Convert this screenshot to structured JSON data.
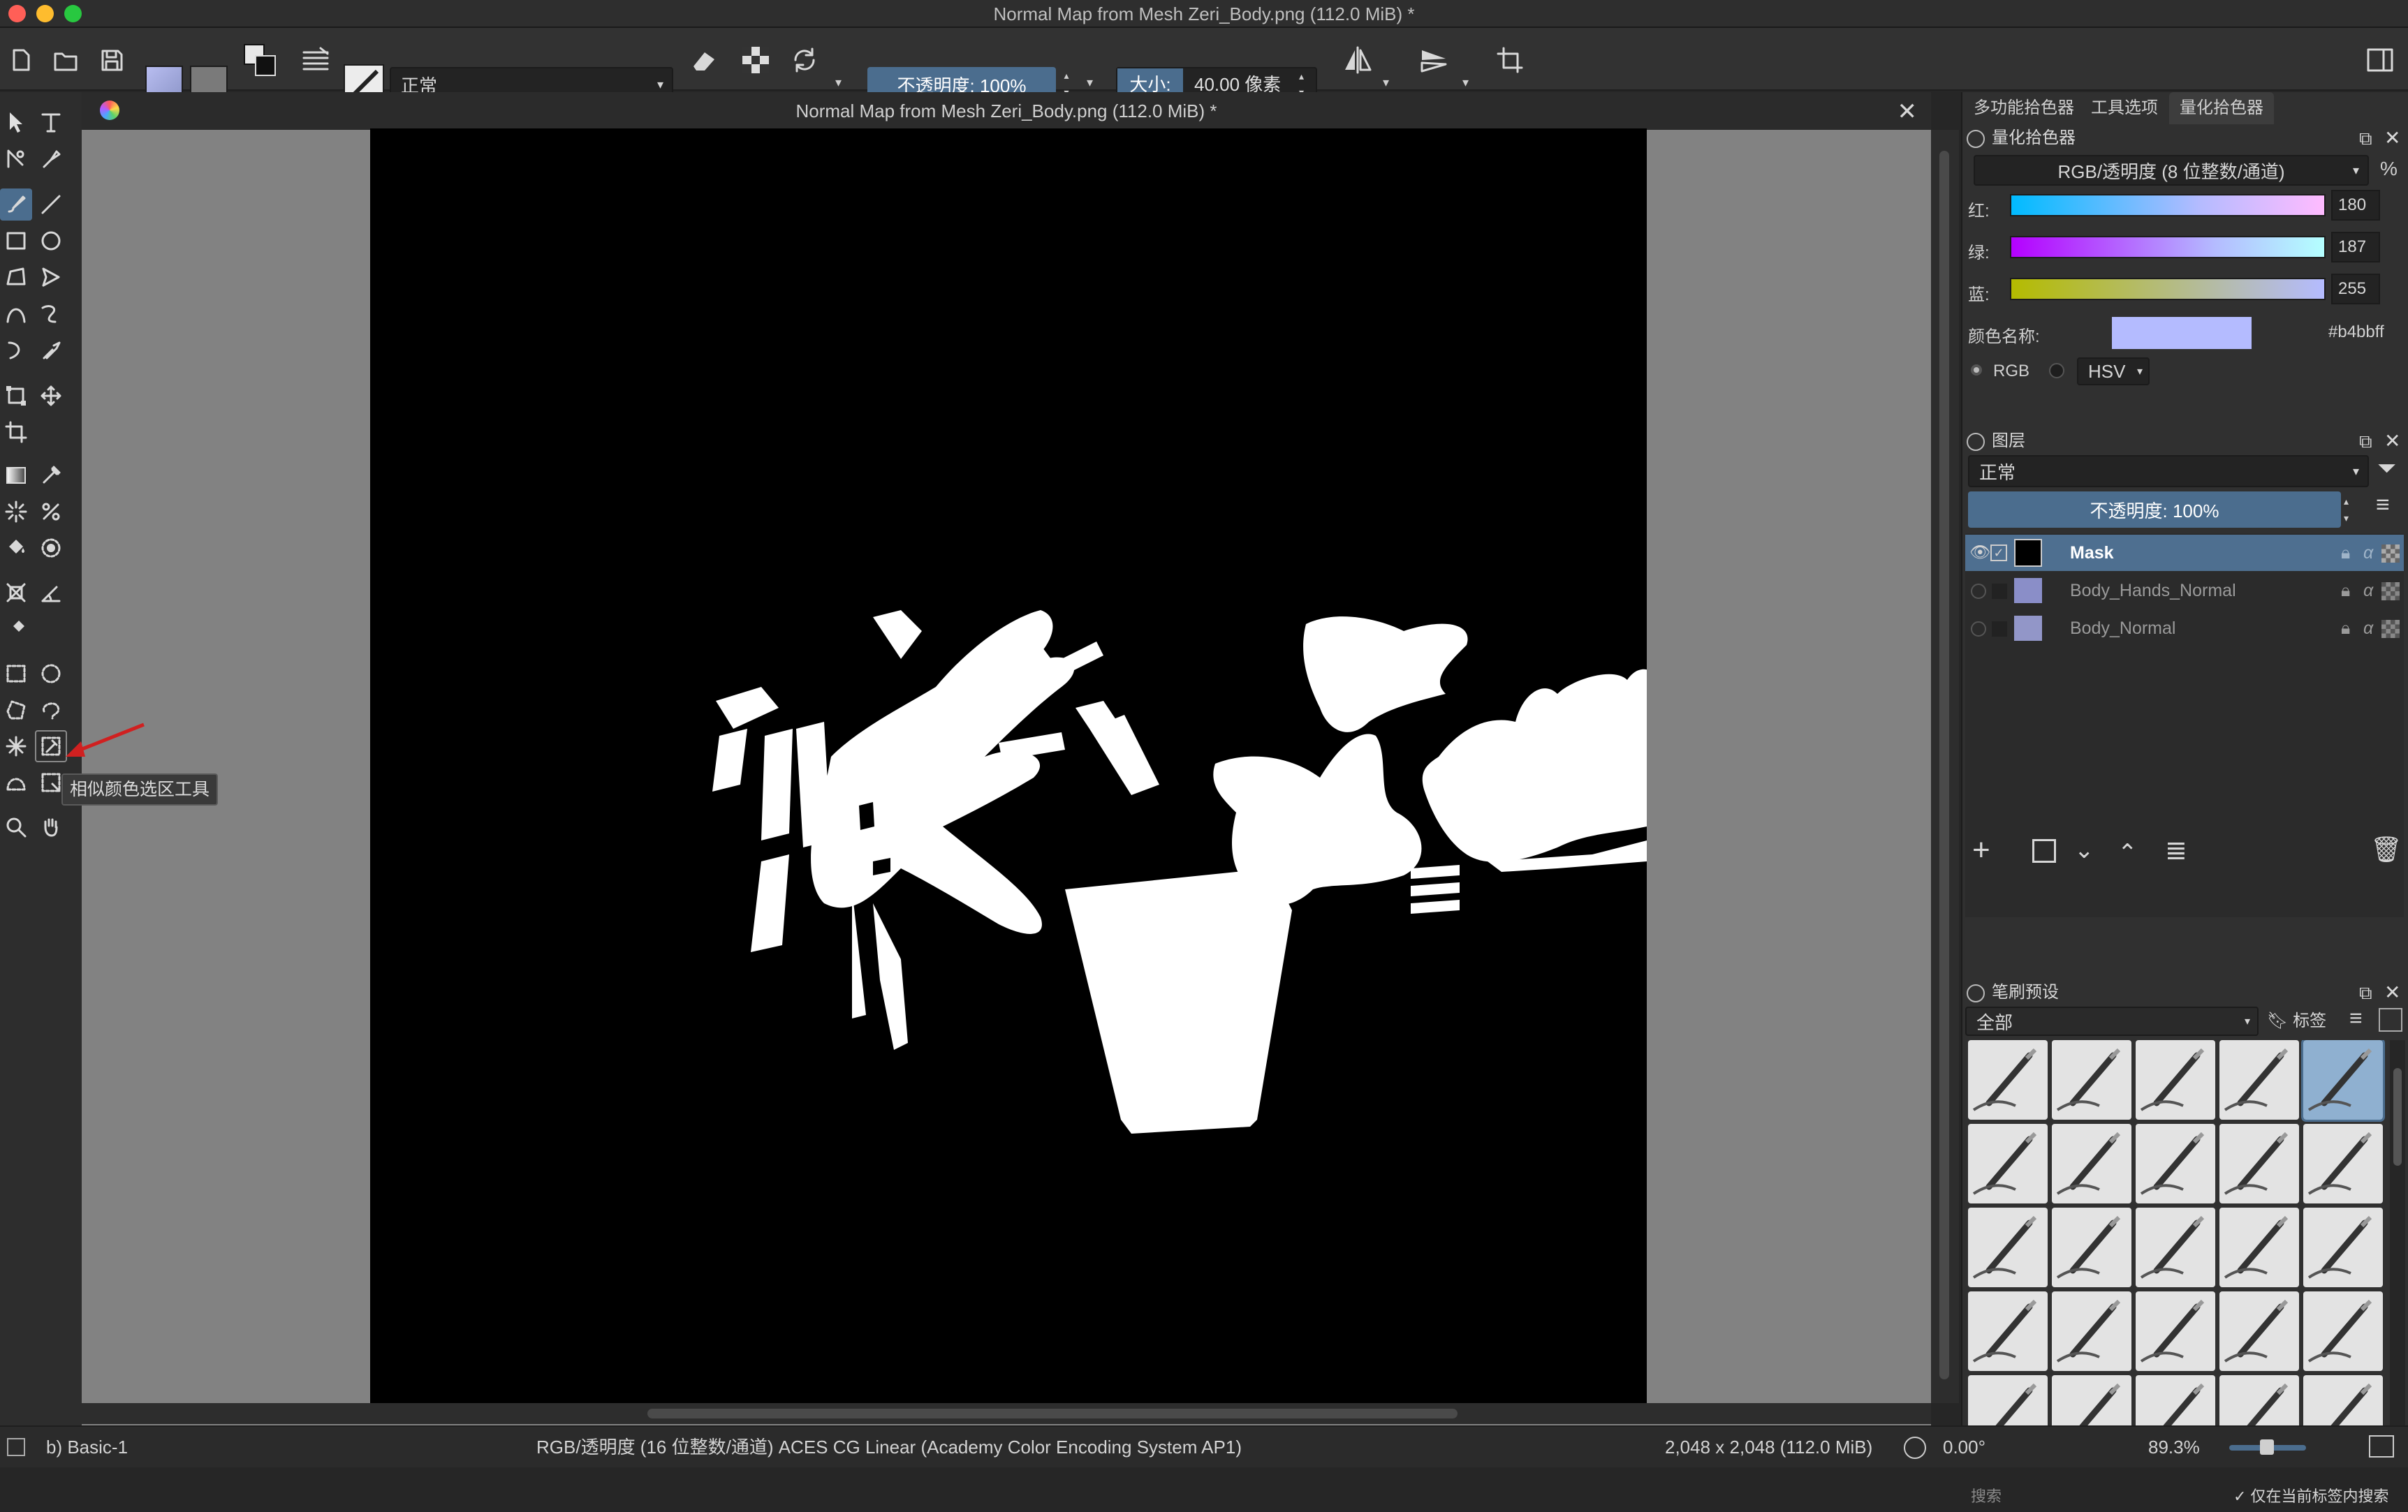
{
  "window": {
    "title": "Normal Map from Mesh Zeri_Body.png (112.0 MiB) *"
  },
  "toolbar": {
    "blend_mode": "正常",
    "opacity": "不透明度:  100%",
    "size_label": "大小:",
    "size_value": "40.00 像素"
  },
  "document": {
    "tab_title": "Normal Map from Mesh Zeri_Body.png (112.0 MiB) *"
  },
  "tooltip": {
    "text": "相似颜色选区工具"
  },
  "panel": {
    "tabs": [
      "多功能拾色器",
      "工具选项",
      "量化拾色器"
    ],
    "active_tab": "量化拾色器",
    "color_selector": {
      "title": "量化拾色器",
      "mode": "RGB/透明度 (8 位整数/通道)",
      "percent_symbol": "%",
      "channels": [
        {
          "label": "红:",
          "value": "180"
        },
        {
          "label": "绿:",
          "value": "187"
        },
        {
          "label": "蓝:",
          "value": "255"
        }
      ],
      "color_name_label": "颜色名称:",
      "hex": "#b4bbff",
      "swatch": "#b4bbff",
      "radio_rgb": "RGB",
      "radio_hsv": "HSV"
    },
    "layers": {
      "title": "图层",
      "blend_mode": "正常",
      "opacity": "不透明度:  100%",
      "items": [
        {
          "name": "Mask",
          "selected": true,
          "visible": true
        },
        {
          "name": "Body_Hands_Normal",
          "selected": false,
          "visible": false
        },
        {
          "name": "Body_Normal",
          "selected": false,
          "visible": false
        }
      ]
    },
    "brush_presets": {
      "title": "笔刷预设",
      "filter": "全部",
      "tag_label": "标签",
      "search_placeholder": "搜索",
      "search_in_tag": "仅在当前标签内搜索"
    }
  },
  "status": {
    "brush": "b) Basic-1",
    "color_space": "RGB/透明度 (16 位整数/通道)  ACES CG Linear (Academy Color Encoding System AP1)",
    "dimensions": "2,048 x 2,048 (112.0 MiB)",
    "rotation": "0.00°",
    "zoom": "89.3%"
  },
  "colors": {
    "accent": "#4b6d8e",
    "selected_layer": "#4e6f90",
    "canvas_bg": "#828282"
  }
}
